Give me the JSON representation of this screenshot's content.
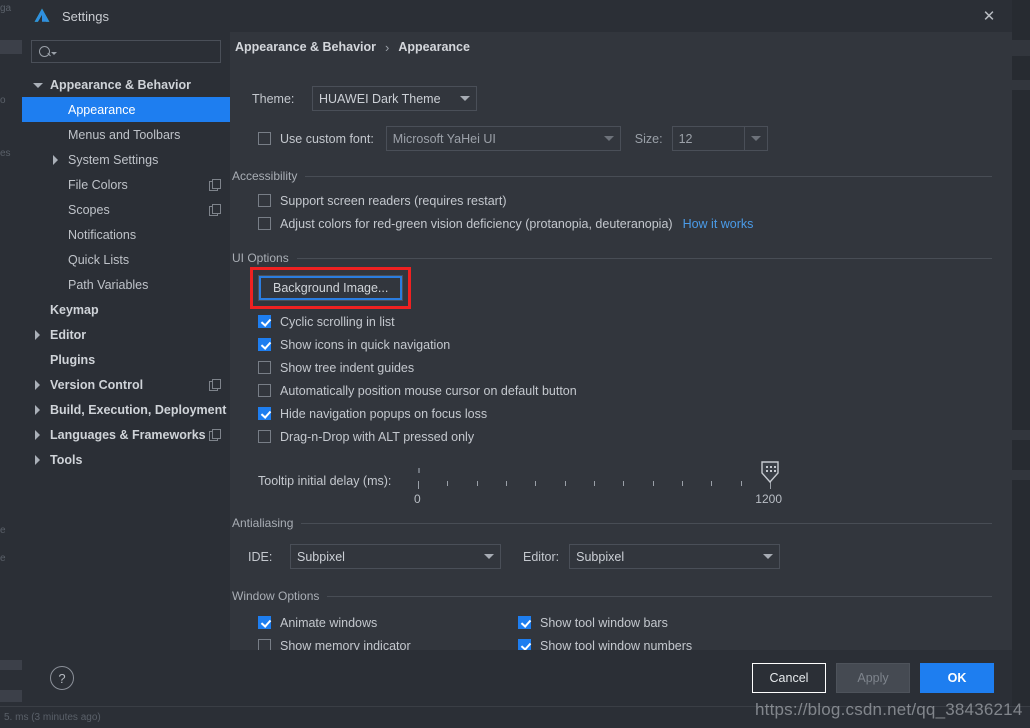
{
  "window": {
    "title": "Settings",
    "logo_icon": "jetbrains-logo-icon",
    "close_icon": "close-icon"
  },
  "sidebar": {
    "search": {
      "placeholder": "",
      "value": "",
      "icon": "search-icon"
    },
    "items": [
      {
        "label": "Appearance & Behavior",
        "indent": 0,
        "arrow": "down",
        "bold": true,
        "selected": false,
        "copy": false
      },
      {
        "label": "Appearance",
        "indent": 1,
        "arrow": "none",
        "bold": false,
        "selected": true,
        "copy": false
      },
      {
        "label": "Menus and Toolbars",
        "indent": 1,
        "arrow": "none",
        "bold": false,
        "selected": false,
        "copy": false
      },
      {
        "label": "System Settings",
        "indent": 1,
        "arrow": "right",
        "bold": false,
        "selected": false,
        "copy": false
      },
      {
        "label": "File Colors",
        "indent": 1,
        "arrow": "none",
        "bold": false,
        "selected": false,
        "copy": true
      },
      {
        "label": "Scopes",
        "indent": 1,
        "arrow": "none",
        "bold": false,
        "selected": false,
        "copy": true
      },
      {
        "label": "Notifications",
        "indent": 1,
        "arrow": "none",
        "bold": false,
        "selected": false,
        "copy": false
      },
      {
        "label": "Quick Lists",
        "indent": 1,
        "arrow": "none",
        "bold": false,
        "selected": false,
        "copy": false
      },
      {
        "label": "Path Variables",
        "indent": 1,
        "arrow": "none",
        "bold": false,
        "selected": false,
        "copy": false
      },
      {
        "label": "Keymap",
        "indent": 0,
        "arrow": "none",
        "bold": true,
        "selected": false,
        "copy": false
      },
      {
        "label": "Editor",
        "indent": 0,
        "arrow": "right",
        "bold": true,
        "selected": false,
        "copy": false
      },
      {
        "label": "Plugins",
        "indent": 0,
        "arrow": "none",
        "bold": true,
        "selected": false,
        "copy": false
      },
      {
        "label": "Version Control",
        "indent": 0,
        "arrow": "right",
        "bold": true,
        "selected": false,
        "copy": true
      },
      {
        "label": "Build, Execution, Deployment",
        "indent": 0,
        "arrow": "right",
        "bold": true,
        "selected": false,
        "copy": false
      },
      {
        "label": "Languages & Frameworks",
        "indent": 0,
        "arrow": "right",
        "bold": true,
        "selected": false,
        "copy": true
      },
      {
        "label": "Tools",
        "indent": 0,
        "arrow": "right",
        "bold": true,
        "selected": false,
        "copy": false
      }
    ]
  },
  "breadcrumb": {
    "root": "Appearance & Behavior",
    "separator": "›",
    "leaf": "Appearance"
  },
  "appearance": {
    "theme_label": "Theme:",
    "theme_value": "HUAWEI Dark Theme",
    "custom_font_label": "Use custom font:",
    "custom_font_checked": false,
    "font_value": "Microsoft YaHei UI",
    "size_label": "Size:",
    "size_value": "12",
    "accessibility": {
      "group": "Accessibility",
      "options": [
        {
          "label": "Support screen readers (requires restart)",
          "checked": false
        },
        {
          "label": "Adjust colors for red-green vision deficiency (protanopia, deuteranopia)",
          "checked": false
        }
      ],
      "link": "How it works"
    },
    "ui_options": {
      "group": "UI Options",
      "background_image_button": "Background Image...",
      "options": [
        {
          "label": "Cyclic scrolling in list",
          "checked": true
        },
        {
          "label": "Show icons in quick navigation",
          "checked": true
        },
        {
          "label": "Show tree indent guides",
          "checked": false
        },
        {
          "label": "Automatically position mouse cursor on default button",
          "checked": false
        },
        {
          "label": "Hide navigation popups on focus loss",
          "checked": true
        },
        {
          "label": "Drag-n-Drop with ALT pressed only",
          "checked": false
        }
      ],
      "tooltip_delay_label": "Tooltip initial delay (ms):",
      "tooltip_delay_min": "0",
      "tooltip_delay_max": "1200",
      "tooltip_delay_value": 1200
    },
    "antialiasing": {
      "group": "Antialiasing",
      "ide_label": "IDE:",
      "ide_value": "Subpixel",
      "editor_label": "Editor:",
      "editor_value": "Subpixel"
    },
    "window_options": {
      "group": "Window Options",
      "left": [
        {
          "label": "Animate windows",
          "checked": true
        },
        {
          "label": "Show memory indicator",
          "checked": false
        }
      ],
      "right": [
        {
          "label": "Show tool window bars",
          "checked": true
        },
        {
          "label": "Show tool window numbers",
          "checked": true
        }
      ]
    }
  },
  "footer": {
    "help_icon": "help-question-icon",
    "help_label": "?",
    "cancel": "Cancel",
    "apply": "Apply",
    "ok": "OK"
  },
  "overlay": {
    "watermark": "https://blog.csdn.net/qq_38436214"
  },
  "background_ide": {
    "left_fragments": [
      "ga",
      "o",
      "es",
      "e",
      "e",
      "5:"
    ],
    "status_text": "5. ms (3 minutes ago)"
  },
  "colors": {
    "accent": "#1e7ef0",
    "dialog_bg": "#2b2f36",
    "panel_bg": "#32363d",
    "highlight_box": "#ef2121",
    "link": "#4a9be8"
  }
}
